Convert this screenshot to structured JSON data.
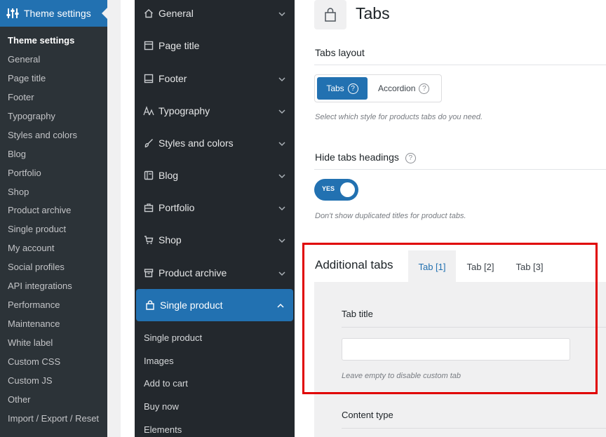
{
  "admin_menu": {
    "top_label": "Theme settings",
    "items": [
      "Theme settings",
      "General",
      "Page title",
      "Footer",
      "Typography",
      "Styles and colors",
      "Blog",
      "Portfolio",
      "Shop",
      "Product archive",
      "Single product",
      "My account",
      "Social profiles",
      "API integrations",
      "Performance",
      "Maintenance",
      "White label",
      "Custom CSS",
      "Custom JS",
      "Other",
      "Import / Export / Reset"
    ]
  },
  "theme_nav": {
    "items": [
      {
        "label": "General",
        "icon": "home-icon"
      },
      {
        "label": "Page title",
        "icon": "page-icon"
      },
      {
        "label": "Footer",
        "icon": "footer-icon"
      },
      {
        "label": "Typography",
        "icon": "typography-icon"
      },
      {
        "label": "Styles and colors",
        "icon": "brush-icon"
      },
      {
        "label": "Blog",
        "icon": "blog-icon"
      },
      {
        "label": "Portfolio",
        "icon": "briefcase-icon"
      },
      {
        "label": "Shop",
        "icon": "cart-icon"
      },
      {
        "label": "Product archive",
        "icon": "archive-icon"
      },
      {
        "label": "Single product",
        "icon": "bag-icon"
      }
    ],
    "sub_items": [
      "Single product",
      "Images",
      "Add to cart",
      "Buy now",
      "Elements"
    ]
  },
  "main": {
    "title": "Tabs",
    "tabs_layout": {
      "label": "Tabs layout",
      "options": [
        "Tabs",
        "Accordion"
      ],
      "selected": "Tabs",
      "help": "Select which style for products tabs do you need."
    },
    "hide_headings": {
      "label": "Hide tabs headings",
      "toggle_text": "YES",
      "help": "Don't show duplicated titles for product tabs."
    },
    "additional_tabs": {
      "title": "Additional tabs",
      "tabs": [
        "Tab [1]",
        "Tab [2]",
        "Tab [3]"
      ],
      "active_tab": "Tab [1]",
      "tab_title_label": "Tab title",
      "tab_title_value": "",
      "tab_title_help": "Leave empty to disable custom tab",
      "content_type_label": "Content type"
    }
  },
  "colors": {
    "accent": "#2271b1",
    "admin_sidebar": "#2c3338",
    "theme_nav": "#23282d",
    "highlight": "#e00000"
  }
}
